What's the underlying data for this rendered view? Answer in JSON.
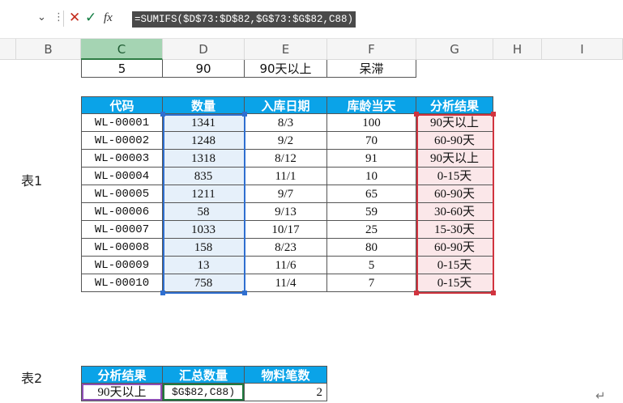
{
  "formula_bar": {
    "formula": "=SUMIFS($D$73:$D$82,$G$73:$G$82,C88)",
    "cancel_icon": "close-icon",
    "confirm_icon": "check-icon",
    "fx_label": "fx"
  },
  "columns": [
    "B",
    "C",
    "D",
    "E",
    "F",
    "G",
    "H",
    "I"
  ],
  "top_row": [
    "5",
    "90",
    "90天以上",
    "呆滞"
  ],
  "table1": {
    "label": "表1",
    "headers": [
      "代码",
      "数量",
      "入库日期",
      "库龄当天",
      "分析结果"
    ],
    "rows": [
      [
        "WL-00001",
        "1341",
        "8/3",
        "100",
        "90天以上"
      ],
      [
        "WL-00002",
        "1248",
        "9/2",
        "70",
        "60-90天"
      ],
      [
        "WL-00003",
        "1318",
        "8/12",
        "91",
        "90天以上"
      ],
      [
        "WL-00004",
        "835",
        "11/1",
        "10",
        "0-15天"
      ],
      [
        "WL-00005",
        "1211",
        "9/7",
        "65",
        "60-90天"
      ],
      [
        "WL-00006",
        "58",
        "9/13",
        "59",
        "30-60天"
      ],
      [
        "WL-00007",
        "1033",
        "10/17",
        "25",
        "15-30天"
      ],
      [
        "WL-00008",
        "158",
        "8/23",
        "80",
        "60-90天"
      ],
      [
        "WL-00009",
        "13",
        "11/6",
        "5",
        "0-15天"
      ],
      [
        "WL-00010",
        "758",
        "11/4",
        "7",
        "0-15天"
      ]
    ]
  },
  "table2": {
    "label": "表2",
    "headers": [
      "分析结果",
      "汇总数量",
      "物料笔数"
    ],
    "row": [
      "90天以上",
      "$G$82,C88)",
      "2"
    ]
  },
  "colors": {
    "header_fill": "#0aa3e8",
    "selected_col": "#a5d4b3",
    "qty_range_fill": "#e6f0fa",
    "qty_range_border": "#2f6fd0",
    "result_range_fill": "#fbe7e9",
    "result_range_border": "#d1343f"
  }
}
